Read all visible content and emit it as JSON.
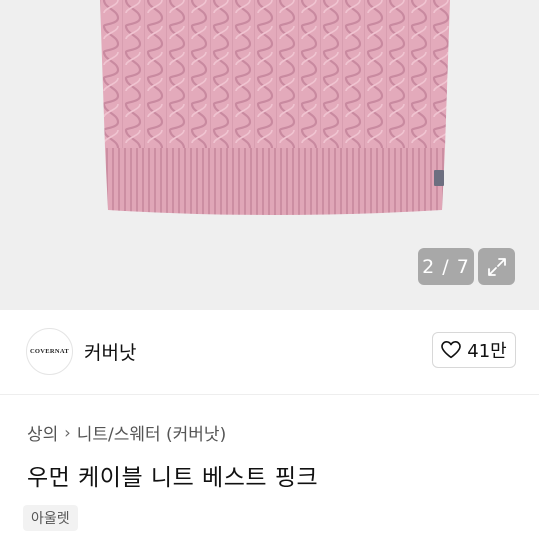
{
  "gallery": {
    "counter": "2 / 7",
    "image_color": "#e2a9b9",
    "expand_icon": "expand-arrows-icon"
  },
  "brand": {
    "logo_text": "COVERNAT",
    "name": "커버낫"
  },
  "like": {
    "icon": "heart-outline-icon",
    "count": "41만"
  },
  "breadcrumb": {
    "category": "상의",
    "subcategory": "니트/스웨터 (커버낫)"
  },
  "product": {
    "title": "우먼 케이블 니트 베스트 핑크",
    "tag": "아울렛"
  }
}
